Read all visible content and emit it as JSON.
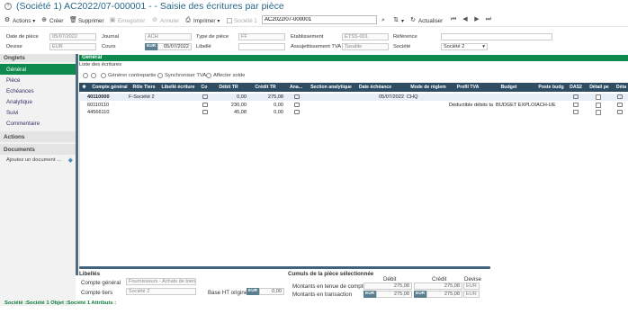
{
  "window": {
    "title": "(Société 1)  AC2022/07-000001 - - Saisie des écritures par pièce"
  },
  "toolbar": {
    "actions": "Actions",
    "create": "Créer",
    "delete": "Supprimer",
    "save": "Enregistrer",
    "cancel": "Annuler",
    "print": "Imprimer",
    "company": "Société 1",
    "search_value": "AC2022/07-000001",
    "refresh": "Actualiser"
  },
  "header_form": {
    "date_piece_label": "Date de pièce",
    "date_piece_value": "05/07/2022",
    "journal_label": "Journal",
    "journal_value": "ACH",
    "type_piece_label": "Type de pièce",
    "type_piece_value": "FF",
    "etablissement_label": "Etablissement",
    "etablissement_value": "ETSS-001",
    "reference_label": "Référence",
    "reference_value": "",
    "devise_label": "Devise",
    "devise_value": "EUR",
    "cours_label": "Cours",
    "cours_currency": "EUR",
    "cours_value": "05/07/2022",
    "libelle_label": "Libellé",
    "libelle_value": "",
    "assujettissement_label": "Assujettissement TVA",
    "assujettissement_value": "Taxable",
    "societe_label": "Société",
    "societe_value": "Société 2"
  },
  "sidebar": {
    "onglets_label": "Onglets",
    "items": [
      {
        "label": "Général"
      },
      {
        "label": "Pièce"
      },
      {
        "label": "Echéances"
      },
      {
        "label": "Analytique"
      },
      {
        "label": "Suivi"
      },
      {
        "label": "Commentaire"
      }
    ],
    "actions_label": "Actions",
    "documents_label": "Documents",
    "add_document": "Ajoutez un document ..."
  },
  "main": {
    "section_title": "Général",
    "subtitle": "Liste des écritures",
    "generate_counterpart": "Générer contrepartie",
    "sync_vat": "Synchroniser TVA",
    "assign_balance": "Affecter solde"
  },
  "grid": {
    "columns": [
      "Compte général",
      "Rôle Tiers",
      "Libellé écriture",
      "Co",
      "Débit TR",
      "Crédit TR",
      "Ana...",
      "Section analytique",
      "Date échéance",
      "Mode de règlem",
      "Profil TVA",
      "Budget",
      "Poste budg",
      "DAS2",
      "Détail pe",
      "Déta"
    ],
    "rows": [
      {
        "compte": "40110000",
        "role": "F-Société 2",
        "debit": "0,00",
        "credit": "275,08",
        "echeance": "05/07/2022",
        "mode": "CHQ",
        "profil": "",
        "budget": "",
        "poste": ""
      },
      {
        "compte": "60110110",
        "role": "",
        "debit": "230,00",
        "credit": "0,00",
        "echeance": "",
        "mode": "",
        "profil": "Déductible débits ta",
        "budget": "BUDGET EXPLOIT",
        "poste": "ACH-UE"
      },
      {
        "compte": "44566110",
        "role": "",
        "debit": "45,08",
        "credit": "0,00",
        "echeance": "",
        "mode": "",
        "profil": "",
        "budget": "",
        "poste": ""
      }
    ]
  },
  "bottom": {
    "libelles_title": "Libellés",
    "compte_general_label": "Compte général",
    "compte_general_value": "Fournisseurs - Achats de biens",
    "compte_tiers_label": "Compte tiers",
    "compte_tiers_value": "Société 2",
    "base_ht_label": "Base HT origine",
    "base_ht_currency": "EUR",
    "base_ht_value": "0,00",
    "cumuls_title": "Cumuls de la pièce sélectionnée",
    "col_debit": "Débit",
    "col_credit": "Crédit",
    "col_devise": "Devise",
    "row1_label": "Montants en tenue de compte",
    "row1_debit": "275,08",
    "row1_credit": "275,08",
    "row1_devise": "EUR",
    "row2_label": "Montants en transaction",
    "row2_debit_cur": "EUR",
    "row2_debit": "275,08",
    "row2_credit_cur": "EUR",
    "row2_credit": "275,08",
    "row2_devise": "EUR"
  },
  "status_bar": {
    "text": "Société :Société 1  Objet :Société 1  Attributs :"
  }
}
